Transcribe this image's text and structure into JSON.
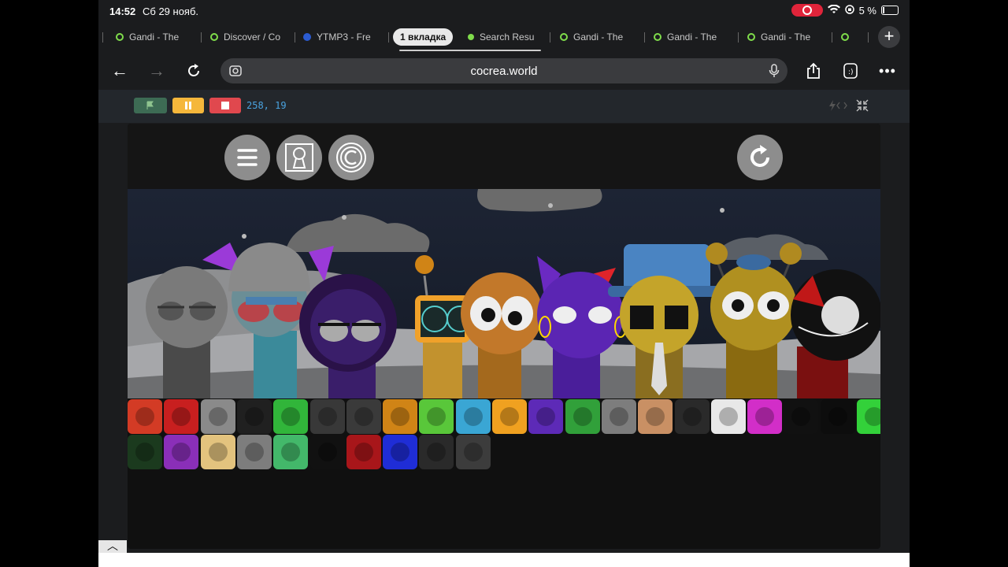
{
  "status": {
    "time": "14:52",
    "date": "Сб 29 нояб.",
    "battery_text": "5 %",
    "record_color": "#e0243a"
  },
  "tabs": [
    {
      "label": "Gandi - The",
      "icon": "scratch-cat-icon"
    },
    {
      "label": "Discover / Co",
      "icon": "scratch-cat-icon"
    },
    {
      "label": "YTMP3 - Fre",
      "icon": "download-icon"
    },
    {
      "label": "1 вкладка",
      "icon": "",
      "active": true
    },
    {
      "label": "Search Resu",
      "icon": "green-dot-icon"
    },
    {
      "label": "Gandi - The",
      "icon": "scratch-cat-icon"
    },
    {
      "label": "Gandi - The",
      "icon": "scratch-cat-icon"
    },
    {
      "label": "Gandi - The",
      "icon": "scratch-cat-icon"
    }
  ],
  "nav": {
    "url": "cocrea.world"
  },
  "scratch": {
    "coords": "258, 19"
  },
  "stage": {
    "top_buttons": [
      "menu-icon",
      "keyhole-icon",
      "copyright-icon"
    ],
    "reset_icon": "reload-icon"
  },
  "colors": {
    "accent": "#4aa3e0",
    "flag": "#3d6b54",
    "pause": "#f5b73b",
    "stop": "#e0484e",
    "stage_bg": "#101010",
    "night_sky": "#1d2434"
  },
  "palette_row1": [
    "#d33b25",
    "#c81f1f",
    "#8a8a8a",
    "#202020",
    "#31b53a",
    "#383838",
    "#3a3a3a",
    "#d08416",
    "#59c73a",
    "#3aa6d4",
    "#f0a120",
    "#5d2ab7",
    "#31a03a",
    "#7d7d7d",
    "#c99064",
    "#2a2a2a",
    "#e8e8e8",
    "#d22ec8",
    "#111111",
    "#0d0d0d",
    "#33d13a"
  ],
  "palette_row2": [
    "#1b3a1e",
    "#8a2fb8",
    "#e3c37e",
    "#7d7d7d",
    "#43b86a",
    "#111111",
    "#a8161a",
    "#1f2dd6",
    "#2a2a2a",
    "#3c3c3c"
  ]
}
